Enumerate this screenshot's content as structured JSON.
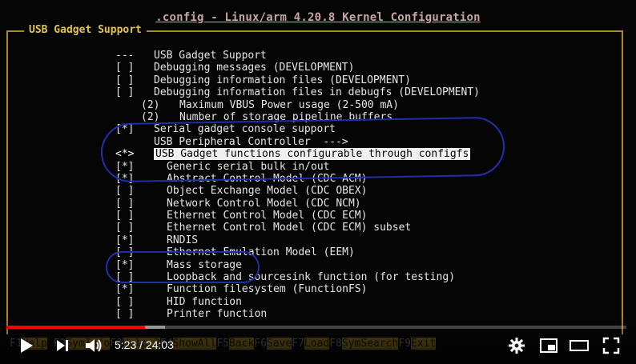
{
  "window_title": ".config - Linux/arm 4.20.8 Kernel Configuration",
  "menu_title": "USB Gadget Support",
  "items": [
    {
      "mark": "---",
      "label": "USB Gadget Support"
    },
    {
      "mark": "[ ]",
      "label": "Debugging messages (DEVELOPMENT)"
    },
    {
      "mark": "[ ]",
      "label": "Debugging information files (DEVELOPMENT)"
    },
    {
      "mark": "[ ]",
      "label": "Debugging information files in debugfs (DEVELOPMENT)"
    },
    {
      "mark": "(2)",
      "label": "Maximum VBUS Power usage (2-500 mA)"
    },
    {
      "mark": "(2)",
      "label": "Number of storage pipeline buffers"
    },
    {
      "mark": "[*]",
      "label": "Serial gadget console support"
    },
    {
      "mark": "",
      "label": "USB Peripheral Controller  --->"
    },
    {
      "mark": "<*>",
      "label": "USB Gadget functions configurable through configfs"
    },
    {
      "mark": "[*]",
      "label": "Generic serial bulk in/out"
    },
    {
      "mark": "[*]",
      "label": "Abstract Control Model (CDC ACM)"
    },
    {
      "mark": "[ ]",
      "label": "Object Exchange Model (CDC OBEX)"
    },
    {
      "mark": "[ ]",
      "label": "Network Control Model (CDC NCM)"
    },
    {
      "mark": "[ ]",
      "label": "Ethernet Control Model (CDC ECM)"
    },
    {
      "mark": "[ ]",
      "label": "Ethernet Control Model (CDC ECM) subset"
    },
    {
      "mark": "[*]",
      "label": "RNDIS"
    },
    {
      "mark": "[ ]",
      "label": "Ethernet Emulation Model (EEM)"
    },
    {
      "mark": "[*]",
      "label": "Mass storage"
    },
    {
      "mark": "[ ]",
      "label": "Loopback and sourcesink function (for testing)"
    },
    {
      "mark": "[*]",
      "label": "Function filesystem (FunctionFS)"
    },
    {
      "mark": "[ ]",
      "label": "HID function"
    },
    {
      "mark": "[ ]",
      "label": "Printer function"
    }
  ],
  "function_keys": [
    {
      "key": "F1",
      "label": "Help"
    },
    {
      "key": "F2",
      "label": "SymInfo"
    },
    {
      "key": "F3",
      "label": "Help 2"
    },
    {
      "key": "F4",
      "label": "ShowAll"
    },
    {
      "key": "F5",
      "label": "Back"
    },
    {
      "key": "F6",
      "label": "Save"
    },
    {
      "key": "F7",
      "label": "Load"
    },
    {
      "key": "F8",
      "label": "SymSearch"
    },
    {
      "key": "F9",
      "label": "Exit"
    }
  ],
  "player": {
    "time": "5:23 / 24:03",
    "progress": 0.224,
    "buffered": 0.256
  },
  "colors": {
    "frame": "#b08a1c",
    "menu_title": "#e4c34a",
    "highlight": "#f0f0f0",
    "pen": "#1f2fa8",
    "progress": "#ff0000"
  }
}
